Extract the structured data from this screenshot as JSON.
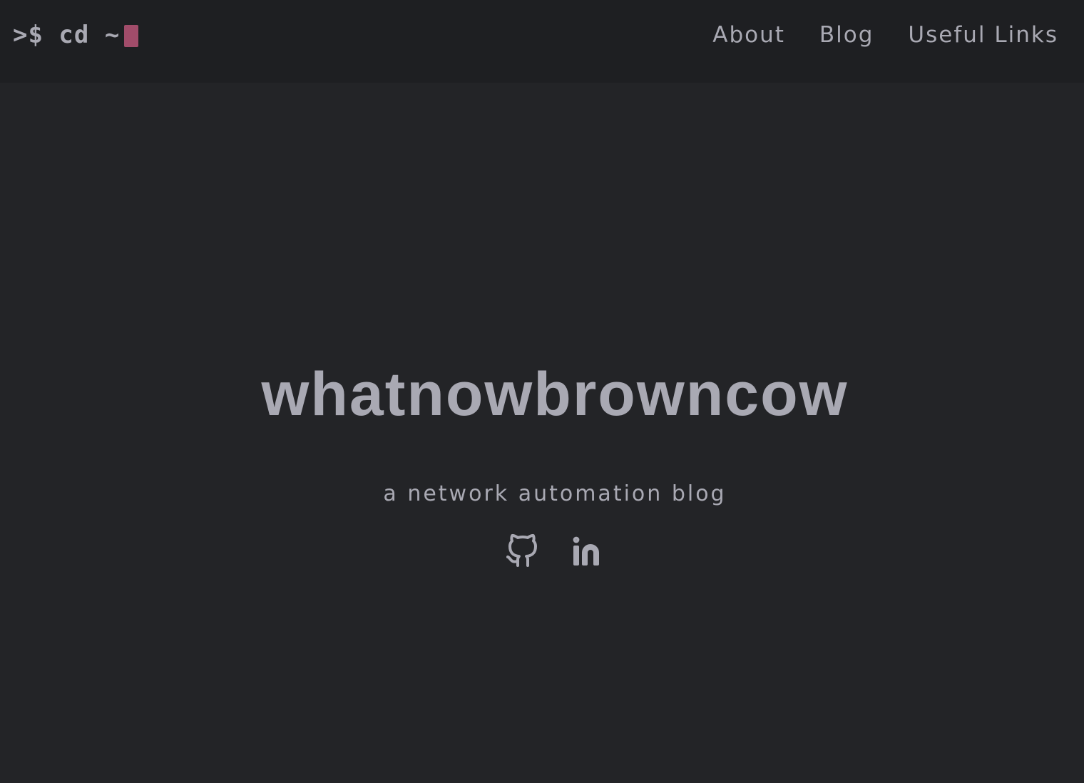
{
  "header": {
    "logo": {
      "prompt": ">$ cd ~",
      "cursor_color": "#a14c6a"
    },
    "nav": [
      {
        "label": "About"
      },
      {
        "label": "Blog"
      },
      {
        "label": "Useful Links"
      }
    ]
  },
  "main": {
    "title": "whatnowbrowncow",
    "subtitle": "a network automation blog",
    "social": [
      {
        "icon": "github-icon"
      },
      {
        "icon": "linkedin-icon"
      }
    ]
  },
  "colors": {
    "background": "#232427",
    "header_background": "#1e1f22",
    "text": "#a9a9b3",
    "accent": "#a14c6a"
  }
}
